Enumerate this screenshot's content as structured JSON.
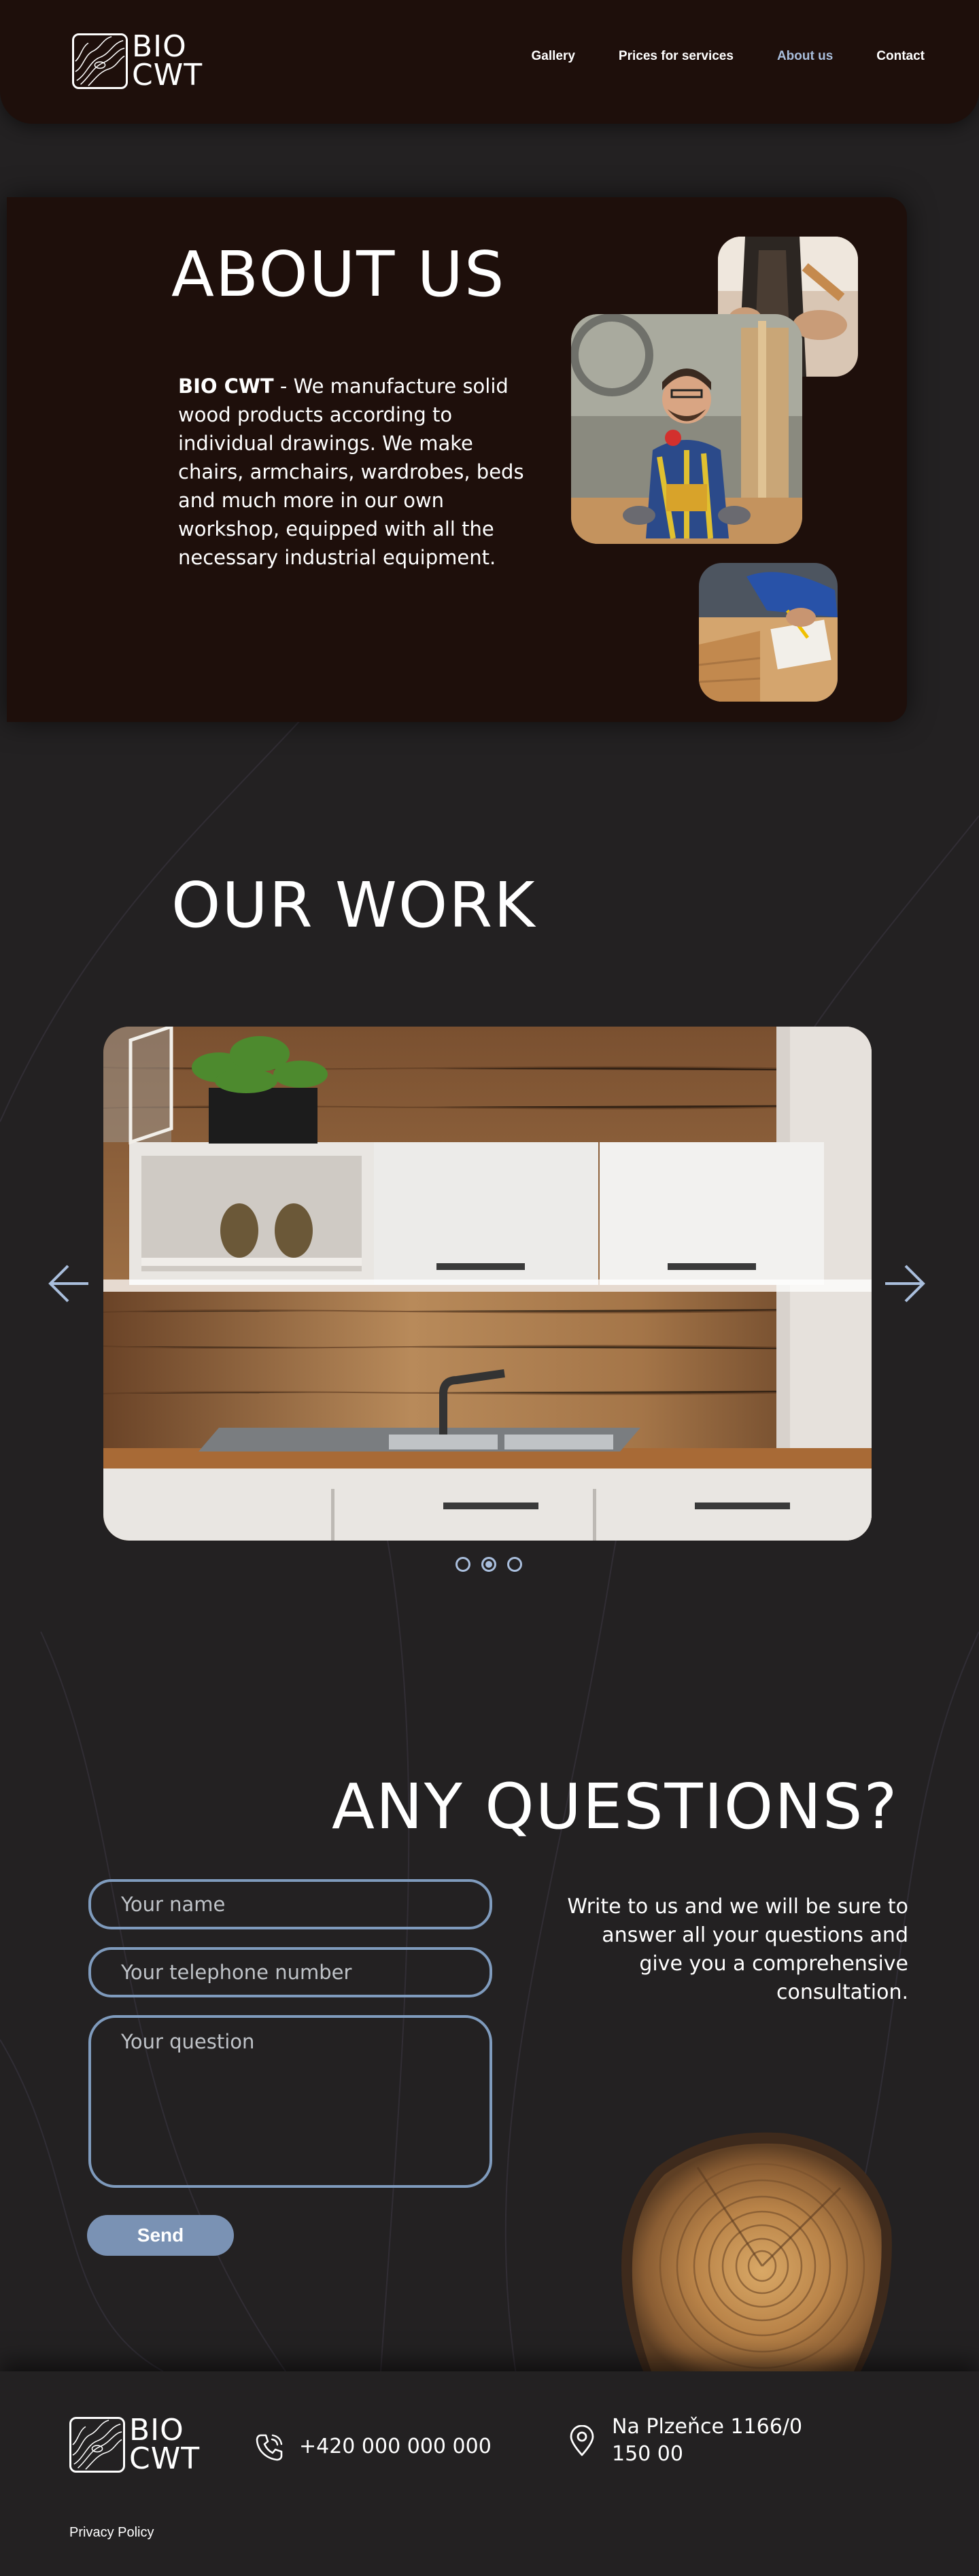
{
  "brand": {
    "line1": "BIO",
    "line2": "CWT"
  },
  "nav": [
    {
      "label": "Gallery",
      "active": false
    },
    {
      "label": "Prices for services",
      "active": false
    },
    {
      "label": "About us",
      "active": true
    },
    {
      "label": "Contact",
      "active": false
    }
  ],
  "about": {
    "title": "ABOUT US",
    "brand_bold": "BIO CWT",
    "text": " - We manufacture solid wood products according to individual drawings. We make chairs, armchairs, wardrobes, beds and much more in our own workshop, equipped with all the necessary industrial equipment."
  },
  "work": {
    "title": "OUR WORK",
    "slide_count": 3,
    "active_slide": 2
  },
  "questions": {
    "title": "ANY QUESTIONS?",
    "description": "Write to us and we will be sure to answer all your questions and give you a comprehensive consultation.",
    "name_placeholder": "Your name",
    "phone_placeholder": "Your telephone number",
    "question_placeholder": "Your question",
    "send_label": "Send"
  },
  "footer": {
    "phone": "+420 000 000 000",
    "address_line1": "Na Plzeňce 1166/0",
    "address_line2": "150 00",
    "privacy": "Privacy Policy"
  },
  "colors": {
    "page_bg": "#232122",
    "panel_bg": "#1e0f0b",
    "accent": "#a9bedc",
    "field_border": "#7f9bbd",
    "button_bg": "#7a92b4"
  },
  "icons": [
    "logo-mark-icon",
    "arrow-left-icon",
    "arrow-right-icon",
    "phone-icon",
    "map-pin-icon"
  ]
}
